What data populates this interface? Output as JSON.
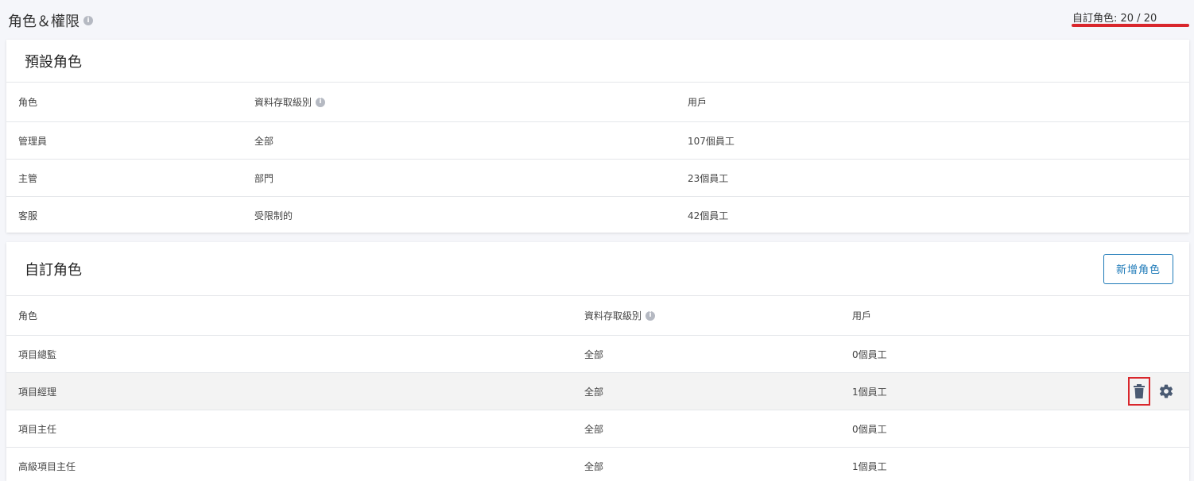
{
  "header": {
    "title": "角色＆權限",
    "title_info_icon": "info-icon",
    "quota_label": "自訂角色: 20 / 20",
    "quota_underline_color": "#d9262c"
  },
  "default_roles": {
    "title": "預設角色",
    "columns": [
      "角色",
      "資料存取級別",
      "用戶"
    ],
    "rows": [
      {
        "role": "管理員",
        "access": "全部",
        "users": "107個員工"
      },
      {
        "role": "主管",
        "access": "部門",
        "users": "23個員工"
      },
      {
        "role": "客服",
        "access": "受限制的",
        "users": "42個員工"
      }
    ]
  },
  "custom_roles": {
    "title": "自訂角色",
    "add_button": "新增角色",
    "columns": [
      "角色",
      "資料存取級別",
      "用戶"
    ],
    "rows": [
      {
        "role": "項目總監",
        "access": "全部",
        "users": "0個員工"
      },
      {
        "role": "項目經理",
        "access": "全部",
        "users": "1個員工"
      },
      {
        "role": "項目主任",
        "access": "全部",
        "users": "0個員工"
      },
      {
        "role": "高級項目主任",
        "access": "全部",
        "users": "1個員工"
      }
    ],
    "row_actions": [
      "trash-icon",
      "gear-icon"
    ],
    "accent_color": "#1e7ab8"
  }
}
